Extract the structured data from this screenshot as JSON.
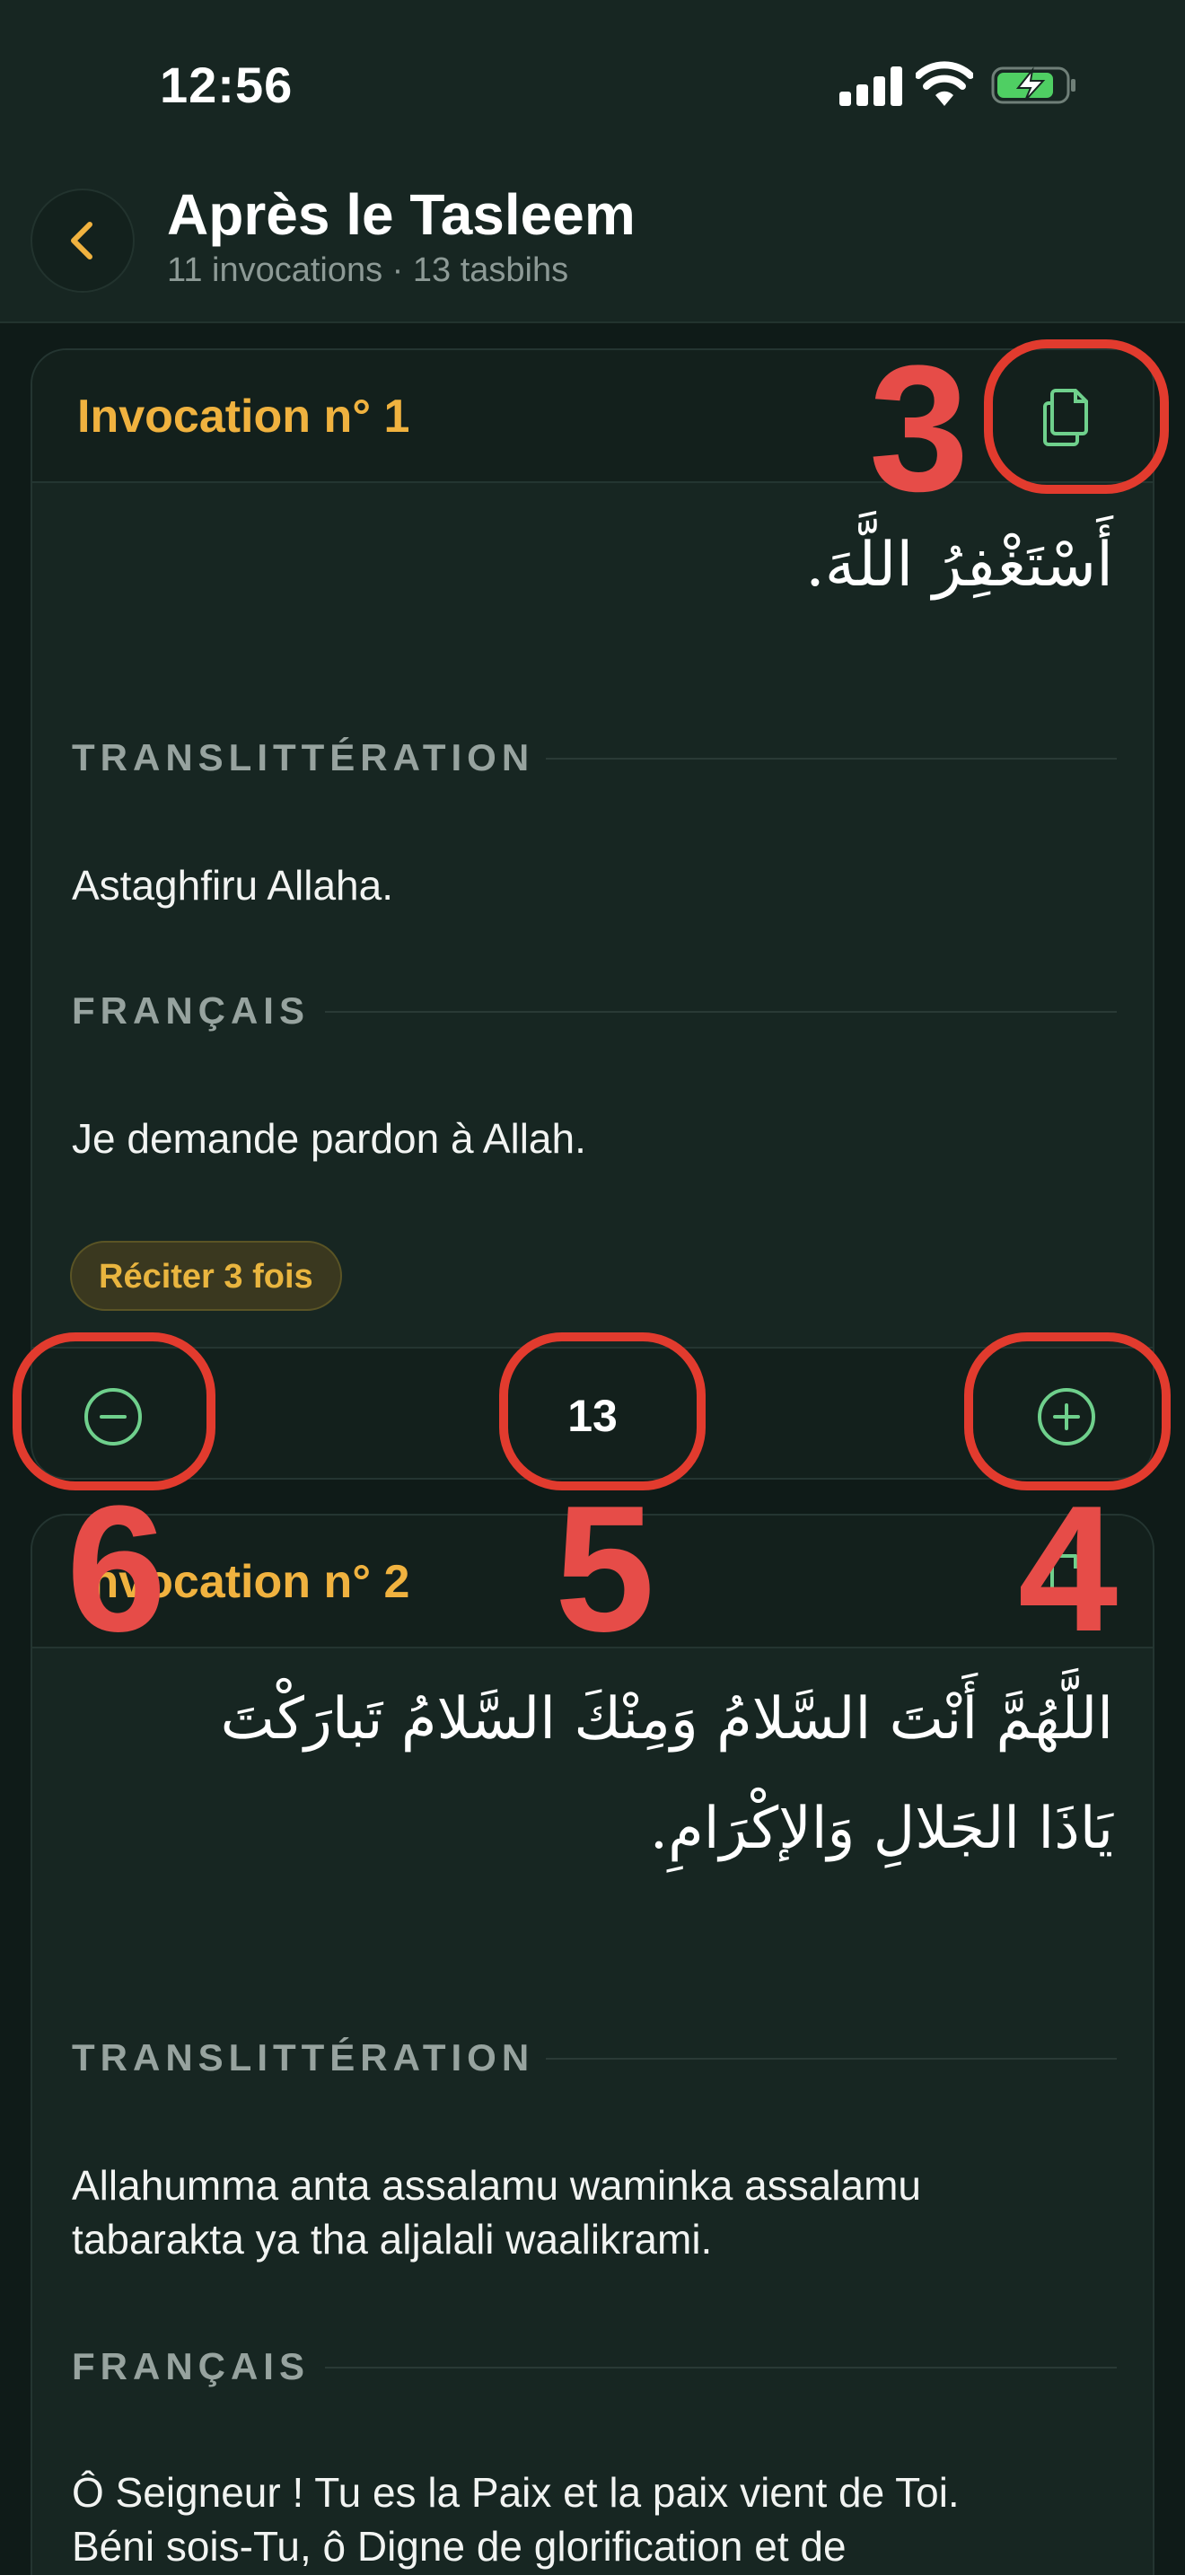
{
  "status_bar": {
    "time": "12:56"
  },
  "header": {
    "title": "Après le Tasleem",
    "subtitle": "11 invocations · 13 tasbihs"
  },
  "invocations": [
    {
      "title": "Invocation n° 1",
      "arabic": "أَسْتَغْفِرُ اللَّهَ.",
      "transliteration_label": "TRANSLITTÉRATION",
      "transliteration": "Astaghfiru Allaha.",
      "french_label": "FRANÇAIS",
      "french": "Je demande pardon à Allah.",
      "badge": "Réciter 3 fois",
      "count": "13"
    },
    {
      "title": "Invocation n° 2",
      "arabic_line1": "اللَّهُمَّ أَنْتَ السَّلامُ وَمِنْكَ السَّلامُ تَبارَكْتَ",
      "arabic_line2": "يَاذَا الجَلالِ وَالإكْرَامِ.",
      "transliteration_label": "TRANSLITTÉRATION",
      "transliteration_line1": "Allahumma anta assalamu waminka assalamu",
      "transliteration_line2": "tabarakta ya tha aljalali waalikrami.",
      "french_label": "FRANÇAIS",
      "french_line1": "Ô Seigneur ! Tu es la Paix et la paix vient de Toi.",
      "french_line2": "Béni sois-Tu, ô Digne de glorification et de"
    }
  ],
  "annotations": [
    "3",
    "4",
    "5",
    "6"
  ],
  "icons": {
    "back": "chevron-left-icon",
    "copy": "copy-icon",
    "decrement": "minus-circle-icon",
    "increment": "plus-circle-icon"
  },
  "colors": {
    "accent": "#f0b23f",
    "icon_green": "#6fd08c",
    "annotation_red": "#e23b2e",
    "background": "#0f1b18",
    "card": "#172622"
  }
}
